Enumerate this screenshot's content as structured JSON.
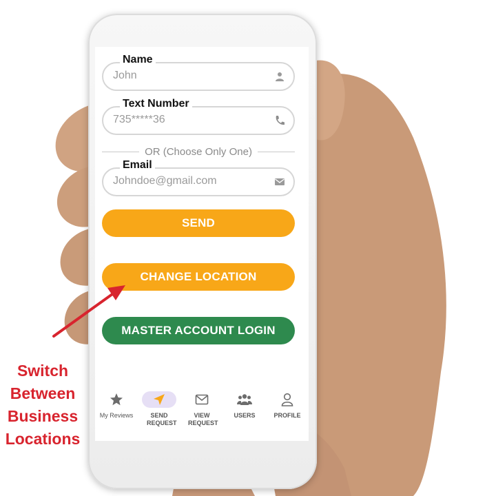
{
  "form": {
    "name": {
      "label": "Name",
      "value": "John",
      "icon": "person-icon"
    },
    "text_number": {
      "label": "Text Number",
      "value": "735*****36",
      "icon": "phone-icon"
    },
    "divider": "OR (Choose Only One)",
    "email": {
      "label": "Email",
      "value": "Johndoe@gmail.com",
      "icon": "mail-icon"
    }
  },
  "buttons": {
    "send": "SEND",
    "change_location": "CHANGE LOCATION",
    "master_login": "MASTER ACCOUNT LOGIN"
  },
  "colors": {
    "accent_orange": "#f8a718",
    "accent_green": "#2e8a4e",
    "annotation_red": "#d8242e",
    "nav_active_pill": "#e6dff5"
  },
  "nav": {
    "items": [
      {
        "label": "My Reviews",
        "icon": "star-icon"
      },
      {
        "label": "SEND REQUEST",
        "icon": "send-icon",
        "active": true
      },
      {
        "label": "VIEW REQUEST",
        "icon": "envelope-icon"
      },
      {
        "label": "USERS",
        "icon": "users-icon"
      },
      {
        "label": "PROFILE",
        "icon": "user-icon"
      }
    ]
  },
  "annotation": {
    "lines": [
      "Switch",
      "Between",
      "Business",
      "Locations"
    ]
  }
}
